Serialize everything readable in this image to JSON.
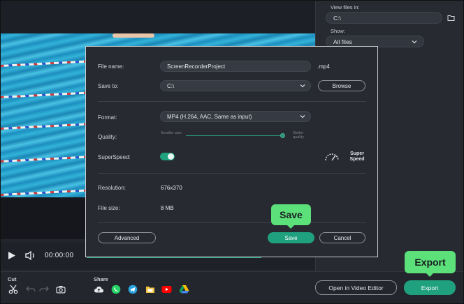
{
  "player": {
    "time": "00:00:00"
  },
  "right_panel": {
    "view_files_label": "View files in:",
    "view_files_value": "C:\\",
    "show_label": "Show:",
    "show_value": "All files"
  },
  "dialog": {
    "file_name_label": "File name:",
    "file_name_value": "ScreenRecorderProject",
    "file_ext": ".mp4",
    "save_to_label": "Save to:",
    "save_to_value": "C:\\",
    "browse_label": "Browse",
    "format_label": "Format:",
    "format_value": "MP4 (H.264, AAC, Same as input)",
    "quality_label": "Quality:",
    "quality_smaller": "Smaller size",
    "quality_better": "Better quality",
    "quality_level": 0.98,
    "superspeed_label": "SuperSpeed:",
    "superspeed_on": true,
    "superspeed_badge": "Super Speed",
    "resolution_label": "Resolution:",
    "resolution_value": "676x370",
    "filesize_label": "File size:",
    "filesize_value": "8 MB",
    "advanced_label": "Advanced",
    "save_label": "Save",
    "cancel_label": "Cancel"
  },
  "bottom_bar": {
    "cut_label": "Cut",
    "share_label": "Share",
    "open_editor_label": "Open in Video Editor",
    "export_label": "Export"
  },
  "callouts": {
    "save": "Save",
    "export": "Export"
  },
  "colors": {
    "accent": "#1fa07f",
    "callout": "#5ce07a"
  },
  "icons": [
    "play-icon",
    "volume-icon",
    "folder-icon",
    "chevron-down-icon",
    "scissors-icon",
    "undo-icon",
    "redo-icon",
    "snapshot-icon",
    "cloud-icon",
    "whatsapp-icon",
    "telegram-icon",
    "google-drive-folder-icon",
    "youtube-icon",
    "google-drive-icon",
    "speedometer-icon"
  ]
}
